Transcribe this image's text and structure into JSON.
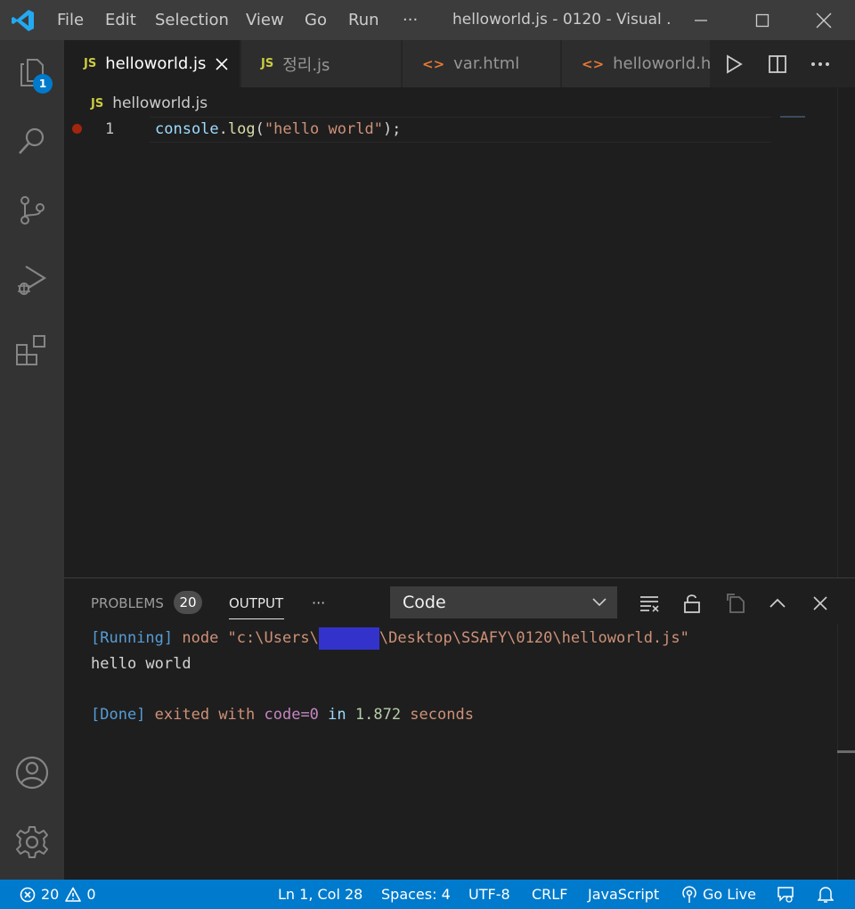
{
  "window": {
    "title": "helloworld.js - 0120 - Visual ...",
    "menu": [
      "File",
      "Edit",
      "Selection",
      "View",
      "Go",
      "Run",
      "···"
    ]
  },
  "activity_bar": {
    "explorer_badge": "1",
    "icons": [
      "explorer-icon",
      "search-icon",
      "source-control-icon",
      "run-debug-icon",
      "extensions-icon",
      "account-icon",
      "settings-gear-icon"
    ]
  },
  "tabs": [
    {
      "icon": "JS",
      "label": "helloworld.js",
      "active": true
    },
    {
      "icon": "JS",
      "label": "정리.js",
      "active": false
    },
    {
      "icon": "<>",
      "label": "var.html",
      "active": false
    },
    {
      "icon": "<>",
      "label": "helloworld.html",
      "active": false
    }
  ],
  "breadcrumb": {
    "icon": "JS",
    "file": "helloworld.js"
  },
  "editor": {
    "line_number": "1",
    "code": {
      "object": "console",
      "dot": ".",
      "method": "log",
      "open": "(",
      "string": "\"hello world\"",
      "close": ");"
    }
  },
  "panel": {
    "tabs": {
      "problems": "PROBLEMS",
      "problems_count": "20",
      "output": "OUTPUT",
      "more": "···"
    },
    "channel": "Code",
    "output": {
      "running_tag": "[Running]",
      "running_cmd_pre": " node \"c:\\Users\\",
      "running_cmd_post": "\\Desktop\\SSAFY\\0120\\helloworld.js\"",
      "result": "hello world",
      "done_tag": "[Done]",
      "done_exited": " exited ",
      "done_with": "with ",
      "done_code": "code=0",
      "done_in": " in ",
      "done_time": "1.872",
      "done_seconds": " seconds"
    }
  },
  "status_bar": {
    "errors": "20",
    "warnings": "0",
    "position": "Ln 1, Col 28",
    "spaces": "Spaces: 4",
    "encoding": "UTF-8",
    "eol": "CRLF",
    "language": "JavaScript",
    "go_live": "Go Live"
  },
  "colors": {
    "accent": "#007acc",
    "title_bar": "#3c3c3c",
    "activity_bar": "#333333",
    "editor_bg": "#1e1e1e"
  }
}
